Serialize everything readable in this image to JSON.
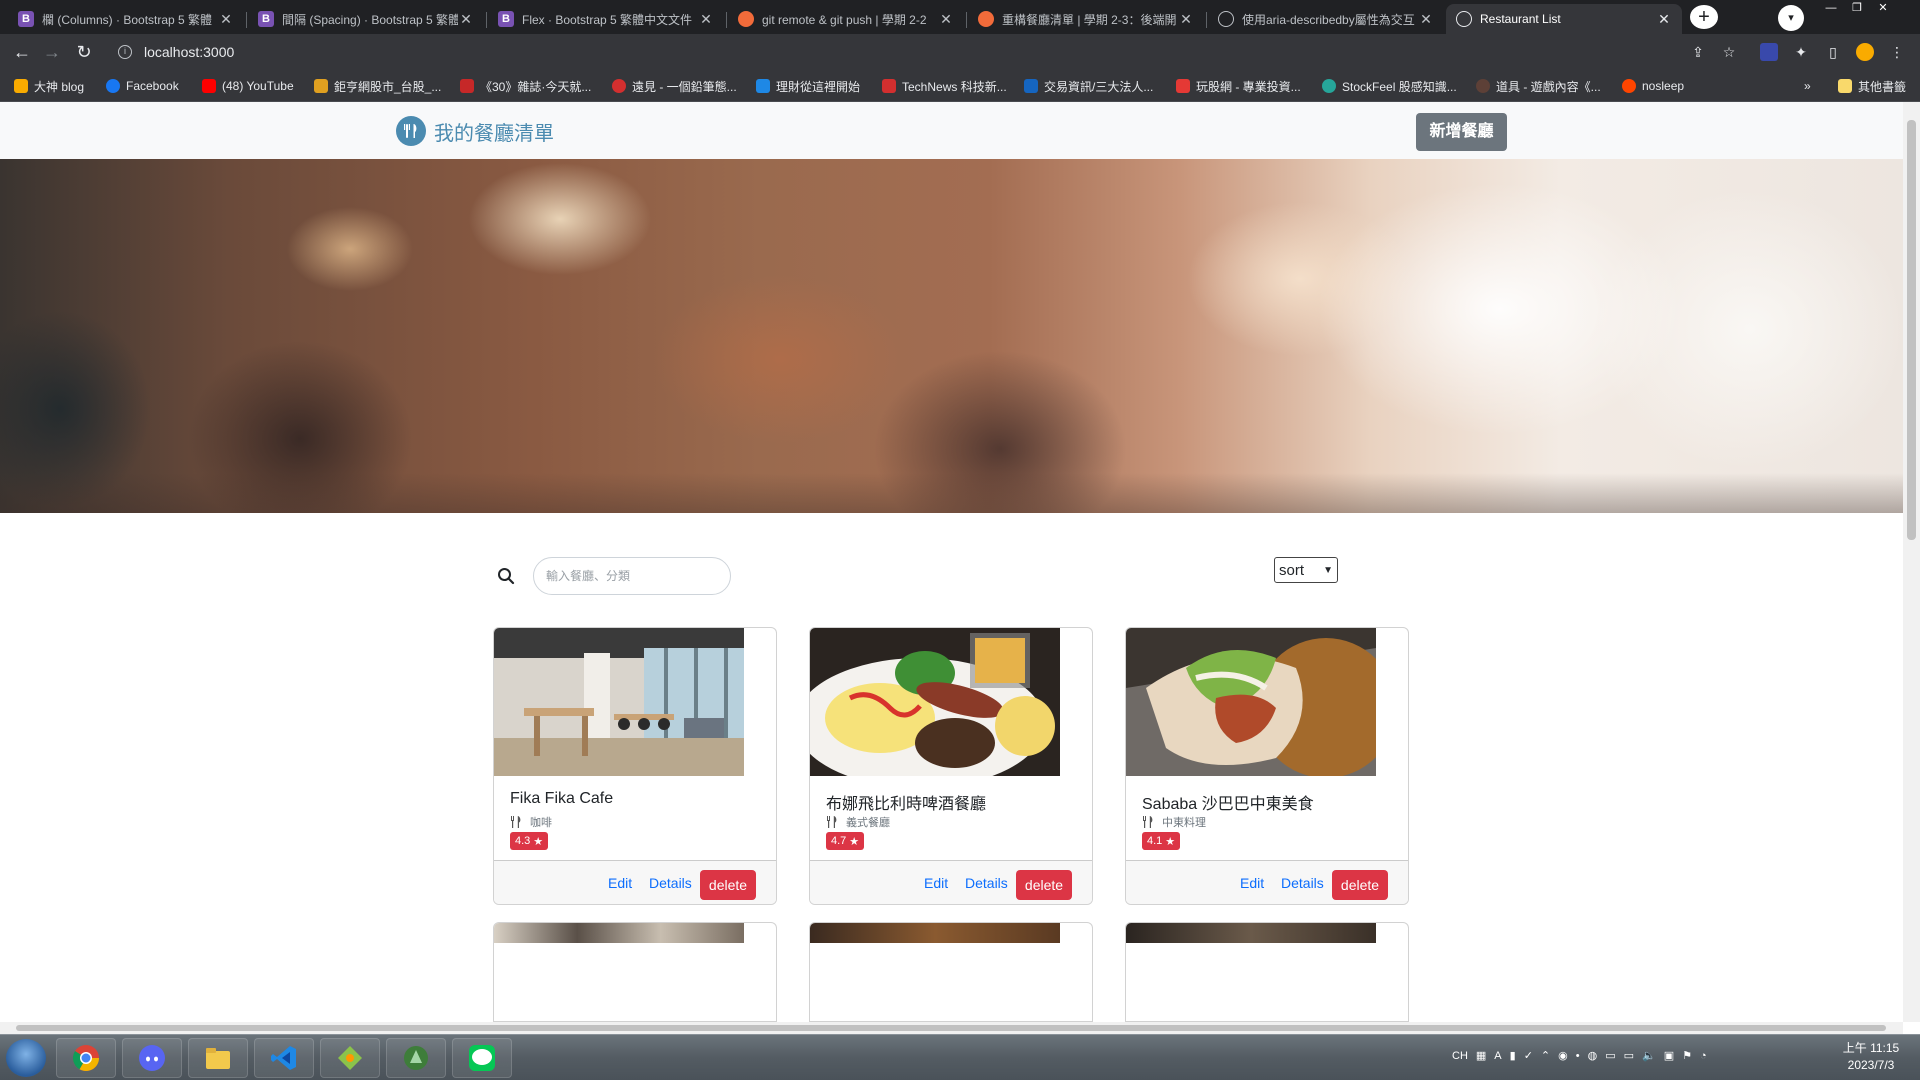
{
  "browser": {
    "tabs": [
      {
        "title": "欄 (Columns) · Bootstrap 5 繁體",
        "icon": "bootstrap-icon",
        "color": "#7952b3"
      },
      {
        "title": "間隔 (Spacing) · Bootstrap 5 繁體",
        "icon": "bootstrap-icon",
        "color": "#7952b3"
      },
      {
        "title": "Flex · Bootstrap 5 繁體中文文件",
        "icon": "bootstrap-icon",
        "color": "#7952b3"
      },
      {
        "title": "git remote & git push | 學期 2-2",
        "icon": "alphacamp-icon",
        "color": "#f26b3a"
      },
      {
        "title": "重構餐廳清單 | 學期 2-3：後端開",
        "icon": "alphacamp-icon",
        "color": "#f26b3a"
      },
      {
        "title": "使用aria-describedby屬性為交互",
        "icon": "globe-icon",
        "color": "#bdc1c6"
      },
      {
        "title": "Restaurant List",
        "icon": "globe-icon",
        "color": "#bdc1c6"
      }
    ],
    "url": "localhost:3000",
    "bookmarks": [
      {
        "label": "大神 blog",
        "color": "#f9ab00"
      },
      {
        "label": "Facebook",
        "color": "#1877f2"
      },
      {
        "label": "(48) YouTube",
        "color": "#ff0000"
      },
      {
        "label": "鉅亨網股市_台股_...",
        "color": "#e0a020"
      },
      {
        "label": "《30》雜誌·今天就...",
        "color": "#c62828"
      },
      {
        "label": "遠見 - 一個鉛筆態...",
        "color": "#d32f2f"
      },
      {
        "label": "理財從這裡開始",
        "color": "#1e88e5"
      },
      {
        "label": "TechNews 科技新...",
        "color": "#d32f2f"
      },
      {
        "label": "交易資訊/三大法人...",
        "color": "#1565c0"
      },
      {
        "label": "玩股網 - 專業投資...",
        "color": "#e53935"
      },
      {
        "label": "StockFeel 股感知識...",
        "color": "#26a69a"
      },
      {
        "label": "道具 - 遊戲內容《...",
        "color": "#5d4037"
      },
      {
        "label": "nosleep",
        "color": "#ff4500"
      }
    ],
    "other_bookmarks": "其他書籤"
  },
  "page": {
    "brand": "我的餐廳清單",
    "add_button": "新增餐廳",
    "search_placeholder": "輸入餐廳、分類",
    "sort_label": "sort",
    "restaurants": [
      {
        "name": "Fika Fika Cafe",
        "category": "咖啡",
        "rating": "4.3",
        "edit": "Edit",
        "details": "Details",
        "delete": "delete"
      },
      {
        "name": "布娜飛比利時啤酒餐廳",
        "category": "義式餐廳",
        "rating": "4.7",
        "edit": "Edit",
        "details": "Details",
        "delete": "delete"
      },
      {
        "name": "Sababa 沙巴巴中東美食",
        "category": "中東料理",
        "rating": "4.1",
        "edit": "Edit",
        "details": "Details",
        "delete": "delete"
      }
    ]
  },
  "taskbar": {
    "tray_text": [
      "CH"
    ],
    "clock_time": "上午 11:15",
    "clock_date": "2023/7/3"
  },
  "colors": {
    "brand": "#4b8bb0",
    "danger": "#dc3545",
    "link": "#0d6efd",
    "secondary": "#6c757d"
  }
}
